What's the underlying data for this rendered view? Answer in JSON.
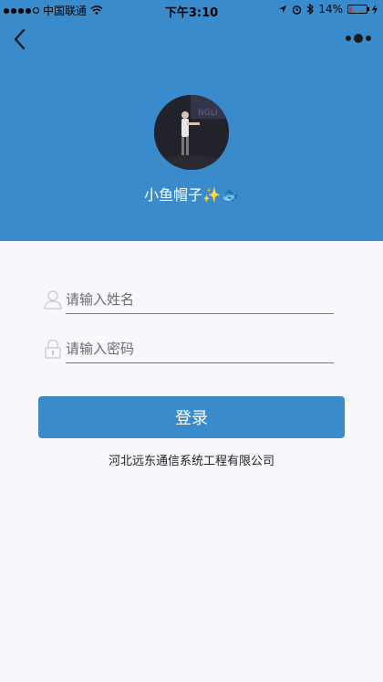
{
  "status_bar": {
    "carrier": "中国联通",
    "time": "下午3:10",
    "battery": "14%",
    "battery_level": 0.14,
    "battery_color": "#e0302e"
  },
  "header": {
    "background_color": "#3a8bcb",
    "nickname": "小鱼帽子",
    "nickname_emoji": "✨🐟"
  },
  "form": {
    "name_placeholder": "请输入姓名",
    "name_value": "",
    "password_placeholder": "请输入密码",
    "password_value": "",
    "login_label": "登录"
  },
  "footer": {
    "company": "河北远东通信系统工程有限公司"
  },
  "icons": {
    "back": "back-arrow-icon",
    "more": "more-icon",
    "user": "user-icon",
    "lock": "lock-icon"
  }
}
